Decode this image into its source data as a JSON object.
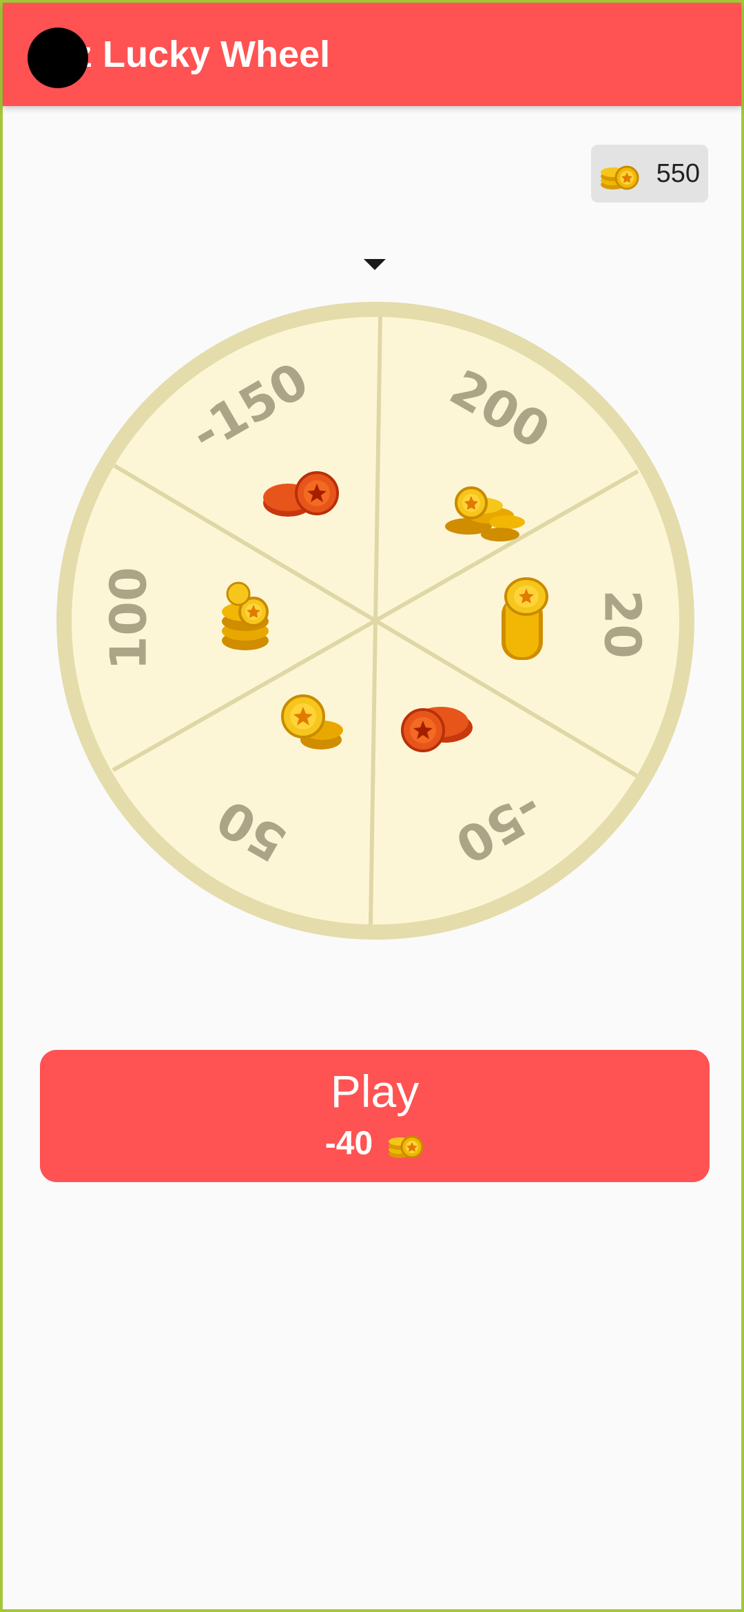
{
  "app_bar": {
    "title": "gz Lucky Wheel"
  },
  "balance": {
    "icon": "coin-stack-icon",
    "value": "550"
  },
  "wheel": {
    "pointer_icon": "triangle-down-icon",
    "segments": [
      {
        "label": "200",
        "icon": "gold-coins-pile-icon"
      },
      {
        "label": "20",
        "icon": "gold-coin-stack-icon"
      },
      {
        "label": "-50",
        "icon": "red-coins-icon"
      },
      {
        "label": "50",
        "icon": "gold-coins-icon"
      },
      {
        "label": "100",
        "icon": "gold-coins-stack-icon"
      },
      {
        "label": "-150",
        "icon": "red-coins-icon"
      }
    ],
    "colors": {
      "segment_fill": "#fdf6d6",
      "rim": "#e4dcaa",
      "divider": "#e0d7a6",
      "label": "#aba486"
    }
  },
  "play": {
    "label": "Play",
    "cost": "-40",
    "cost_icon": "coin-stack-icon"
  },
  "colors": {
    "accent": "#ff5252",
    "background": "#fafafa"
  }
}
